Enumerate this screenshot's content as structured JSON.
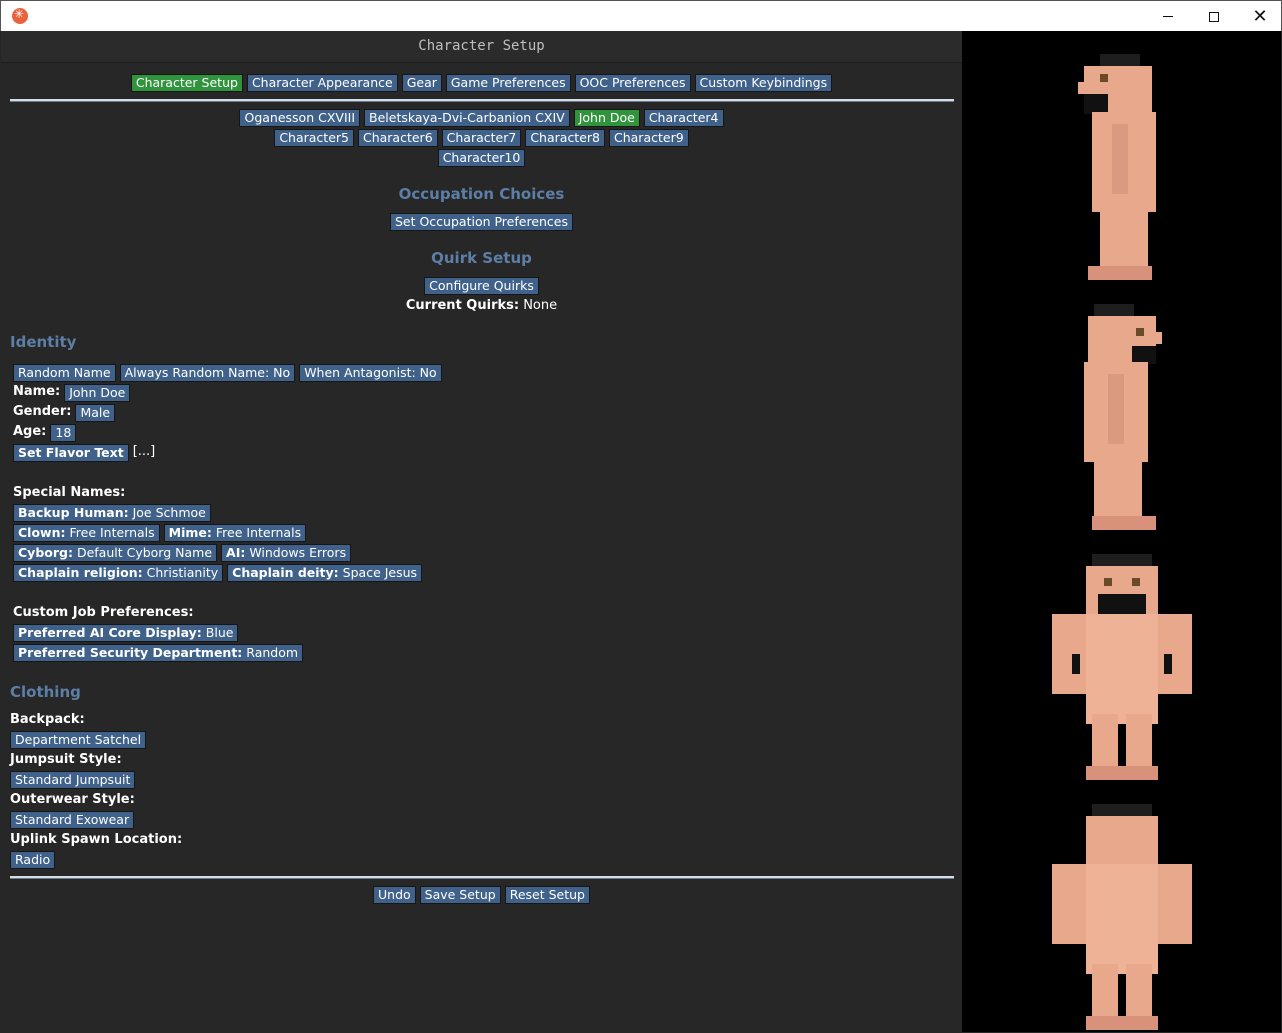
{
  "window": {
    "title": "Character Setup"
  },
  "tabs": [
    "Character Setup",
    "Character Appearance",
    "Gear",
    "Game Preferences",
    "OOC Preferences",
    "Custom Keybindings"
  ],
  "characters_row1": [
    "Oganesson CXVIII",
    "Beletskaya-Dvi-Carbanion CXIV",
    "John Doe",
    "Character4"
  ],
  "characters_row2": [
    "Character5",
    "Character6",
    "Character7",
    "Character8",
    "Character9"
  ],
  "characters_row3": [
    "Character10"
  ],
  "occupation": {
    "heading": "Occupation Choices",
    "button": "Set Occupation Preferences"
  },
  "quirks": {
    "heading": "Quirk Setup",
    "button": "Configure Quirks",
    "current_label": "Current Quirks:",
    "current_value": "None"
  },
  "identity": {
    "heading": "Identity",
    "random_name": "Random Name",
    "always_random": "Always Random Name: No",
    "when_antag": "When Antagonist: No",
    "name_label": "Name:",
    "name_value": "John Doe",
    "gender_label": "Gender:",
    "gender_value": "Male",
    "age_label": "Age:",
    "age_value": "18",
    "flavor_button": "Set Flavor Text",
    "flavor_value": "[...]",
    "special_names_label": "Special Names:",
    "backup_human_label": "Backup Human:",
    "backup_human_value": "Joe Schmoe",
    "clown_label": "Clown:",
    "clown_value": "Free Internals",
    "mime_label": "Mime:",
    "mime_value": "Free Internals",
    "cyborg_label": "Cyborg:",
    "cyborg_value": "Default Cyborg Name",
    "ai_label": "AI:",
    "ai_value": "Windows Errors",
    "religion_label": "Chaplain religion:",
    "religion_value": "Christianity",
    "deity_label": "Chaplain deity:",
    "deity_value": "Space Jesus",
    "custom_job_label": "Custom Job Preferences:",
    "ai_core_label": "Preferred AI Core Display:",
    "ai_core_value": "Blue",
    "sec_dept_label": "Preferred Security Department:",
    "sec_dept_value": "Random"
  },
  "clothing": {
    "heading": "Clothing",
    "backpack_label": "Backpack:",
    "backpack_value": "Department Satchel",
    "jumpsuit_label": "Jumpsuit Style:",
    "jumpsuit_value": "Standard Jumpsuit",
    "outerwear_label": "Outerwear Style:",
    "outerwear_value": "Standard Exowear",
    "uplink_label": "Uplink Spawn Location:",
    "uplink_value": "Radio"
  },
  "footer": {
    "undo": "Undo",
    "save": "Save Setup",
    "reset": "Reset Setup"
  },
  "colors": {
    "button": "#40628a",
    "selected": "#2f943c",
    "heading": "#5d7ea6",
    "background": "#272727",
    "skin": "#e8a88c"
  }
}
